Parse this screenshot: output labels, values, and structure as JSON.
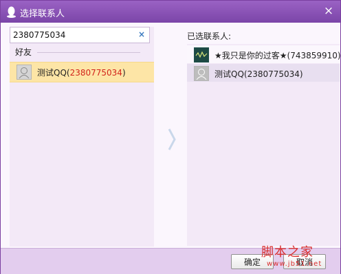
{
  "window": {
    "title": "选择联系人",
    "close_label": "×"
  },
  "search": {
    "value": "2380775034",
    "clear_label": "×"
  },
  "left": {
    "group_label": "好友",
    "contacts": [
      {
        "name": "测试QQ(",
        "id": "2380775034",
        "suffix": ")"
      }
    ]
  },
  "right": {
    "title": "已选联系人:",
    "selected": [
      {
        "name": "★我只是你的过客★(743859910)"
      },
      {
        "name": "测试QQ(2380775034)"
      }
    ]
  },
  "buttons": {
    "ok": "确定",
    "cancel": "取消"
  },
  "watermark": {
    "title": "脚本之家",
    "url": "www.jb51.net"
  },
  "colors": {
    "titlebar": "#8a52b6",
    "highlight": "#fde5a6",
    "match_red": "#d2231a"
  },
  "icons": [
    "qq-penguin-icon",
    "close-icon",
    "clear-search-icon",
    "default-avatar-icon",
    "user-avatar-icon",
    "chevron-right-icon"
  ]
}
